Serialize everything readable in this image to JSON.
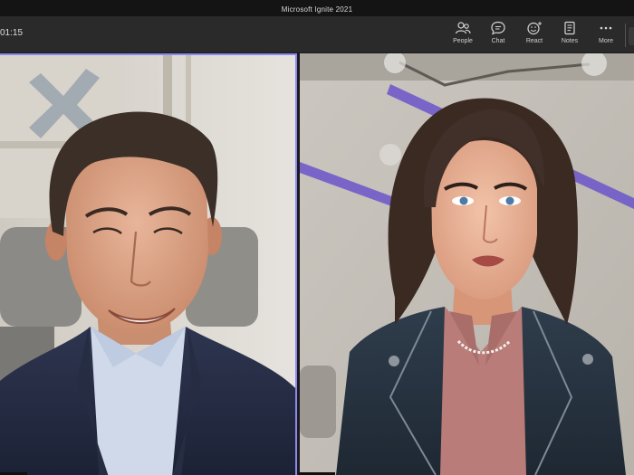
{
  "window": {
    "title": "Microsoft Ignite 2021"
  },
  "call": {
    "duration": "01:15"
  },
  "toolbar": {
    "buttons": [
      {
        "id": "people",
        "label": "People",
        "icon": "people-icon"
      },
      {
        "id": "chat",
        "label": "Chat",
        "icon": "chat-icon"
      },
      {
        "id": "react",
        "label": "React",
        "icon": "react-icon"
      },
      {
        "id": "notes",
        "label": "Notes",
        "icon": "notes-icon"
      },
      {
        "id": "more",
        "label": "More",
        "icon": "more-icon"
      }
    ]
  },
  "colors": {
    "active_speaker_border": "#8b88f0",
    "toolbar_bg": "#2a2a2a",
    "titlebar_bg": "#141414"
  },
  "participants": [
    {
      "tile": "video-tile-presenter",
      "active": true
    },
    {
      "tile": "video-tile-avatar",
      "active": false
    }
  ]
}
